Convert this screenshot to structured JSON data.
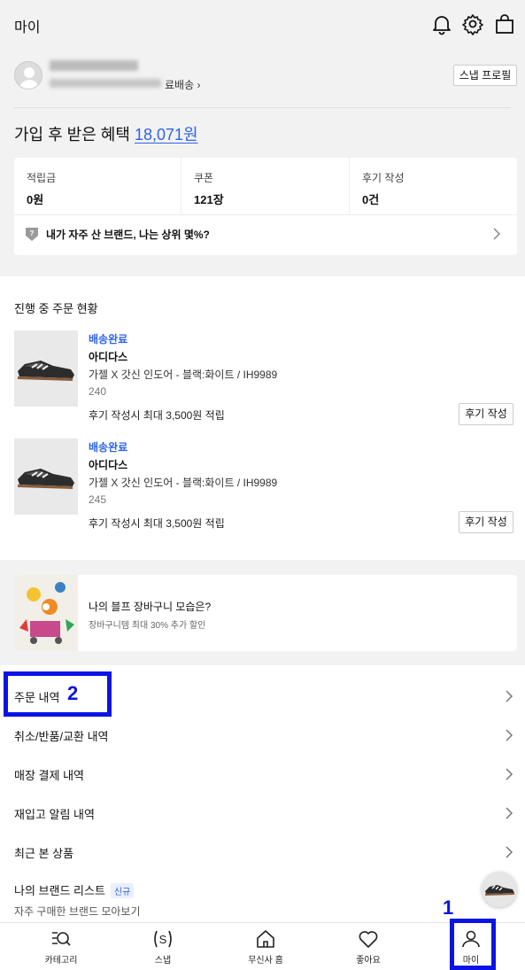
{
  "header": {
    "title": "마이",
    "icons": [
      "bell-icon",
      "gear-icon",
      "shopping-bag-icon"
    ]
  },
  "profile": {
    "info_suffix": "료배송 ›",
    "snap_button": "스냅 프로필"
  },
  "benefit": {
    "prefix": "가입 후 받은 혜택 ",
    "amount": "18,071원"
  },
  "stats": [
    {
      "label": "적립금",
      "value": "0원"
    },
    {
      "label": "쿠폰",
      "value": "121장"
    },
    {
      "label": "후기 작성",
      "value": "0건"
    }
  ],
  "rank_banner": "내가 자주 산 브랜드, 나는 상위 몇%?",
  "orders": {
    "title": "진행 중 주문 현황",
    "items": [
      {
        "status": "배송완료",
        "brand": "아디다스",
        "name": "가젤 X 갓신 인도어 - 블랙:화이트 / IH9989",
        "size": "240",
        "review_text": "후기 작성시 최대 3,500원 적립",
        "review_button": "후기 작성"
      },
      {
        "status": "배송완료",
        "brand": "아디다스",
        "name": "가젤 X 갓신 인도어 - 블랙:화이트 / IH9989",
        "size": "245",
        "review_text": "후기 작성시 최대 3,500원 적립",
        "review_button": "후기 작성"
      }
    ]
  },
  "banner": {
    "title": "나의 블프 장바구니 모습은?",
    "subtitle": "장바구니템 최대 30% 추가 할인"
  },
  "menu": {
    "items": [
      "주문 내역",
      "취소/반품/교환 내역",
      "매장 결제 내역",
      "재입고 알림 내역",
      "최근 본 상품"
    ],
    "brand_list": {
      "label": "나의 브랜드 리스트",
      "badge": "신규",
      "sub": "자주 구매한 브랜드 모아보기"
    }
  },
  "annotations": {
    "one": "1",
    "two": "2",
    "color": "#0a14e6"
  },
  "tabs": [
    {
      "label": "카테고리",
      "icon": "category-search-icon"
    },
    {
      "label": "스냅",
      "icon": "snap-icon"
    },
    {
      "label": "무신사 홈",
      "icon": "home-icon"
    },
    {
      "label": "좋아요",
      "icon": "heart-icon"
    },
    {
      "label": "마이",
      "icon": "person-icon"
    }
  ],
  "colors": {
    "accent": "#2f62e8",
    "background": "#f2f2f2"
  }
}
